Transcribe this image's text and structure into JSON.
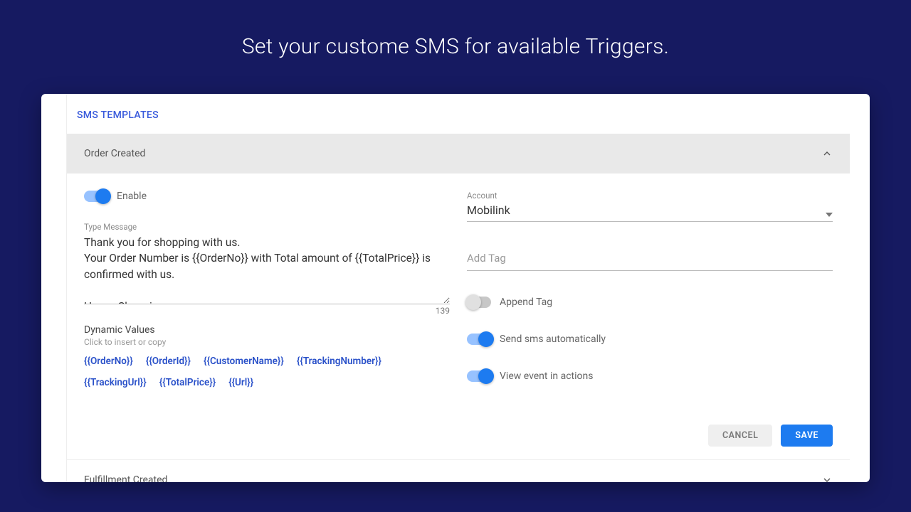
{
  "page_title": "Set your custome SMS for available Triggers.",
  "section_title": "SMS TEMPLATES",
  "template": {
    "name": "Order Created",
    "enable": {
      "label": "Enable",
      "value": true
    },
    "message": {
      "label": "Type Message",
      "value": "Thank you for shopping with us.\nYour Order Number is {{OrderNo}} with Total amount of {{TotalPrice}} is confirmed with us.\n\nHappy Shopping",
      "char_count": "139"
    },
    "dynamic_values": {
      "title": "Dynamic Values",
      "subtitle": "Click to insert or copy",
      "items": [
        "{{OrderNo}}",
        "{{OrderId}}",
        "{{CustomerName}}",
        "{{TrackingNumber}}",
        "{{TrackingUrl}}",
        "{{TotalPrice}}",
        "{{Url}}"
      ]
    },
    "account": {
      "label": "Account",
      "value": "Mobilink"
    },
    "add_tag": {
      "placeholder": "Add Tag",
      "value": ""
    },
    "toggles": {
      "append_tag": {
        "label": "Append Tag",
        "value": false
      },
      "send_auto": {
        "label": "Send sms automatically",
        "value": true
      },
      "view_events": {
        "label": "View event in actions",
        "value": true
      }
    },
    "actions": {
      "cancel": "Cancel",
      "save": "Save"
    }
  },
  "collapsed_template": {
    "name": "Fulfillment Created"
  }
}
